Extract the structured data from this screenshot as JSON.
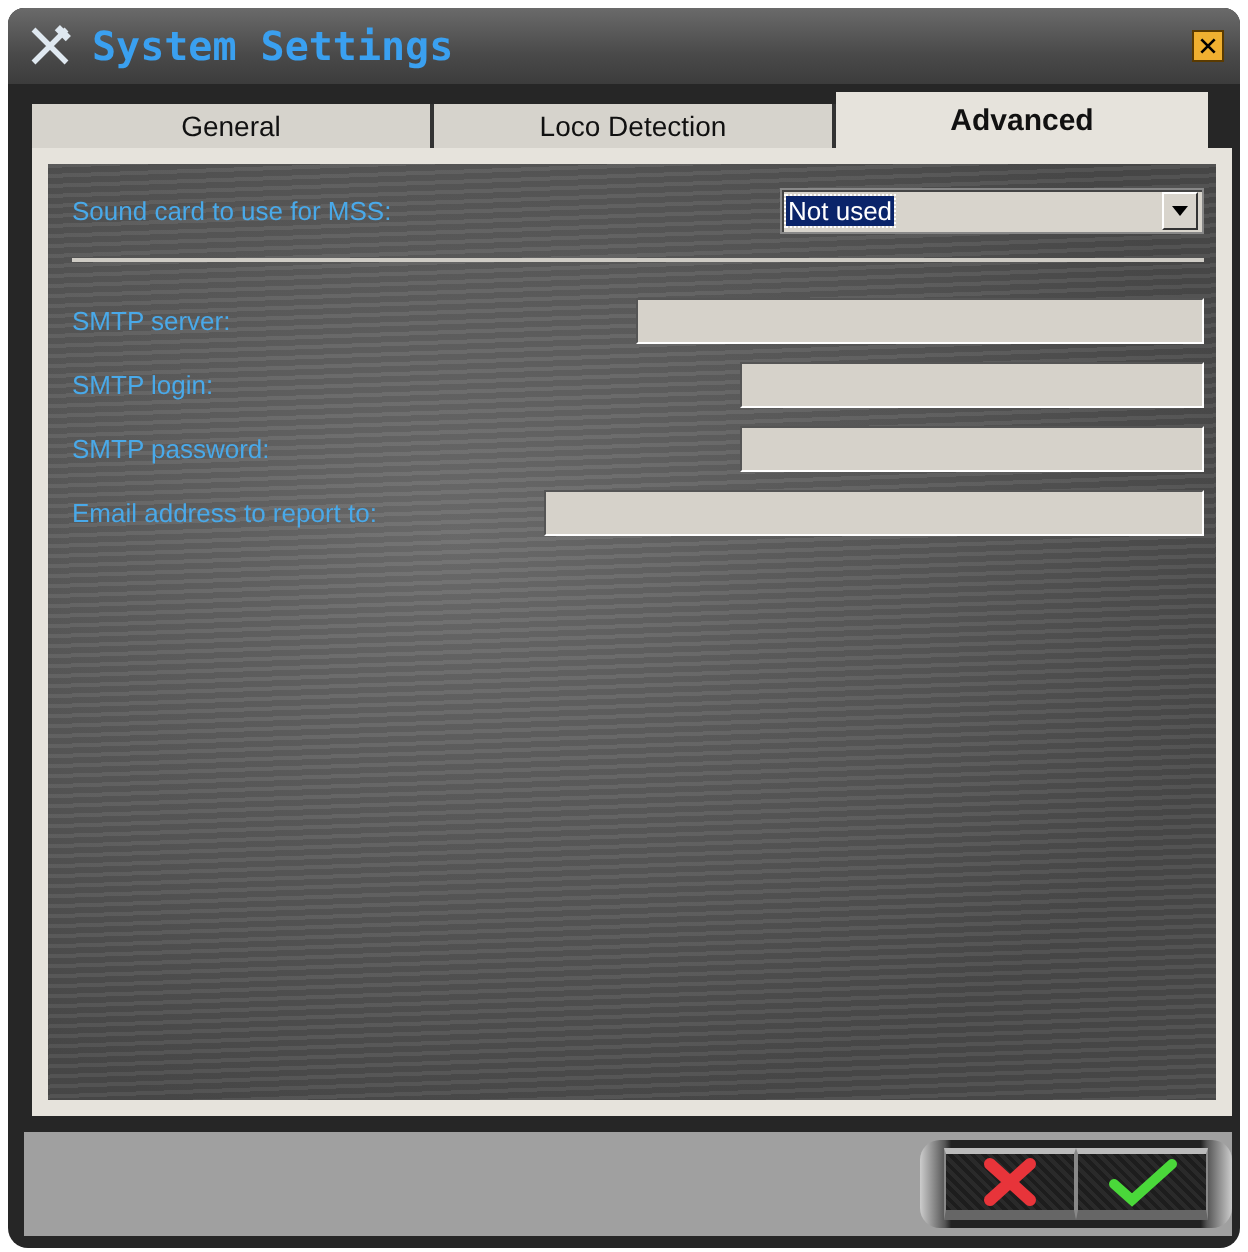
{
  "window": {
    "title": "System Settings"
  },
  "tabs": [
    {
      "label": "General",
      "selected": false
    },
    {
      "label": "Loco Detection",
      "selected": false
    },
    {
      "label": "Advanced",
      "selected": true
    }
  ],
  "sound_card": {
    "label": "Sound card to use for MSS:",
    "value": "Not used"
  },
  "fields": [
    {
      "label": "SMTP server:"
    },
    {
      "label": "SMTP login:"
    },
    {
      "label": "SMTP password:"
    },
    {
      "label": "Email address to report to:"
    }
  ],
  "buttons": [
    {
      "kind": "cancel"
    },
    {
      "kind": "ok"
    }
  ]
}
